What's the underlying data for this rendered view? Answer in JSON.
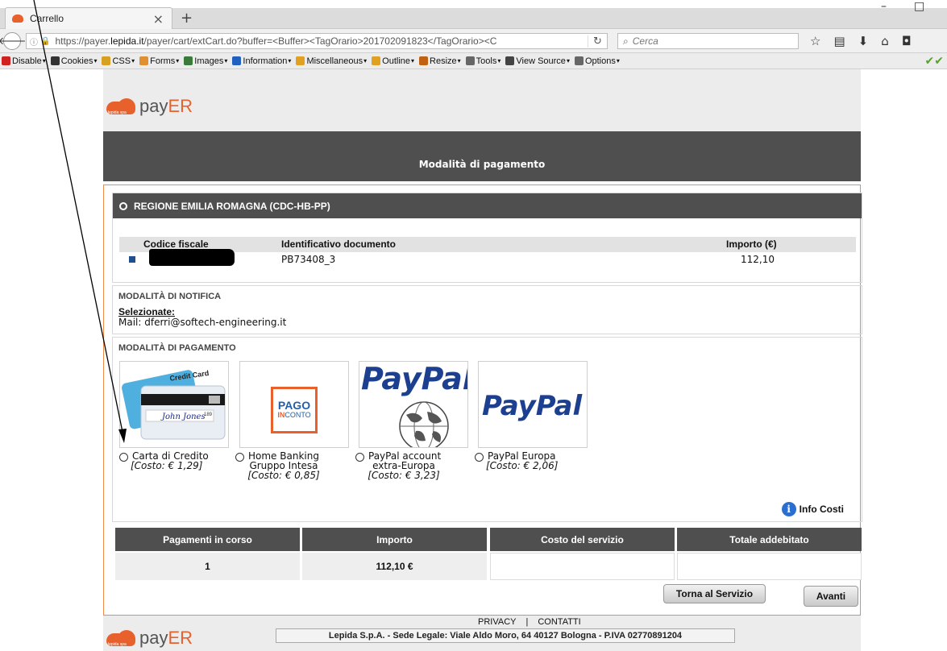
{
  "browser": {
    "tab_title": "Carrello",
    "tab_close": "×",
    "new_tab": "+",
    "url_prefix": "https://payer.",
    "url_domain": "lepida.it",
    "url_rest": "/payer/cart/extCart.do?buffer=<Buffer><TagOrario>201702091823</TagOrario><C",
    "search_placeholder": "Cerca",
    "window_minimize": "–",
    "window_maximize": "□"
  },
  "webdev_toolbar": {
    "items": [
      "Disable",
      "Cookies",
      "CSS",
      "Forms",
      "Images",
      "Information",
      "Miscellaneous",
      "Outline",
      "Resize",
      "Tools",
      "View Source",
      "Options"
    ],
    "icon_colors": [
      "#d02020",
      "#333333",
      "#d8a020",
      "#e09030",
      "#3a7a3a",
      "#2060c0",
      "#e0a020",
      "#e0a020",
      "#c06010",
      "#666666",
      "#444444",
      "#666666"
    ]
  },
  "header": {
    "brand_pre": "pay",
    "brand_post": "ER",
    "brand_sub": "lepida spa"
  },
  "page_title": "Modalità di pagamento",
  "entity": {
    "name": "REGIONE EMILIA ROMAGNA (CDC-HB-PP)",
    "columns": [
      "Codice fiscale",
      "Identificativo documento",
      "Importo (€)"
    ],
    "row": {
      "document_id": "PB73408_3",
      "amount": "112,10"
    }
  },
  "notification": {
    "title": "MODALITÀ DI NOTIFICA",
    "selected_label": "Selezionate:",
    "mail": "Mail: dferri@softech-engineering.it"
  },
  "payment": {
    "title": "MODALITÀ DI PAGAMENTO",
    "methods": [
      {
        "label": "Carta di Credito",
        "label2": "",
        "cost": "[Costo: € 1,29]"
      },
      {
        "label": "Home Banking",
        "label2": "Gruppo Intesa",
        "cost": "[Costo: € 0,85]"
      },
      {
        "label": "PayPal account",
        "label2": "extra-Europa",
        "cost": "[Costo: € 3,23]"
      },
      {
        "label": "PayPal Europa",
        "label2": "",
        "cost": "[Costo: € 2,06]"
      }
    ],
    "card_text": "Credit Card",
    "card_signature": "John Jones",
    "card_sig_num": "189",
    "pago_line1": "PAGO",
    "pago_line2": "IN",
    "pago_line3": "CONTO",
    "paypal_logo": "PayPal",
    "info_costi": "Info Costi"
  },
  "summary": {
    "headers": [
      "Pagamenti in corso",
      "Importo",
      "Costo del servizio",
      "Totale addebitato"
    ],
    "values": [
      "1",
      "112,10 €",
      "",
      ""
    ]
  },
  "buttons": {
    "back": "Torna al Servizio",
    "next": "Avanti"
  },
  "footer": {
    "privacy": "PRIVACY",
    "separator": "|",
    "contacts": "CONTATTI",
    "company": "Lepida S.p.A. - Sede Legale: Viale Aldo Moro, 64 40127 Bologna - P.IVA 02770891204"
  }
}
